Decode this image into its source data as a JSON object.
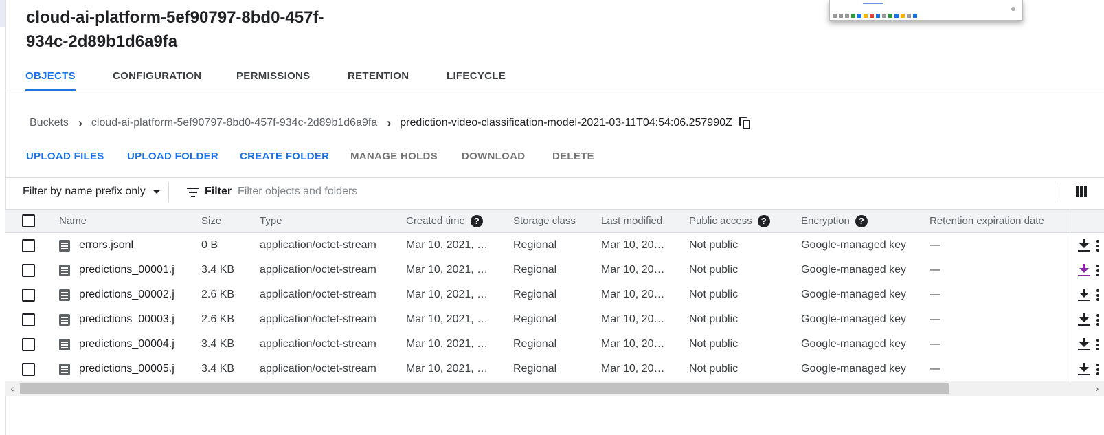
{
  "bucket_title": "cloud-ai-platform-5ef90797-8bd0-457f-934c-2d89b1d6a9fa",
  "tabs": [
    {
      "label": "OBJECTS",
      "active": true
    },
    {
      "label": "CONFIGURATION"
    },
    {
      "label": "PERMISSIONS"
    },
    {
      "label": "RETENTION"
    },
    {
      "label": "LIFECYCLE"
    }
  ],
  "breadcrumb": {
    "root": "Buckets",
    "bucket": "cloud-ai-platform-5ef90797-8bd0-457f-934c-2d89b1d6a9fa",
    "folder": "prediction-video-classification-model-2021-03-11T04:54:06.257990Z"
  },
  "actions": {
    "upload_files": "UPLOAD FILES",
    "upload_folder": "UPLOAD FOLDER",
    "create_folder": "CREATE FOLDER",
    "manage_holds": "MANAGE HOLDS",
    "download": "DOWNLOAD",
    "delete": "DELETE"
  },
  "filter": {
    "prefix_mode": "Filter by name prefix only",
    "label": "Filter",
    "placeholder": "Filter objects and folders"
  },
  "table": {
    "headers": {
      "name": "Name",
      "size": "Size",
      "type": "Type",
      "created": "Created time",
      "storage": "Storage class",
      "modified": "Last modified",
      "public": "Public access",
      "encryption": "Encryption",
      "retention": "Retention expiration date"
    },
    "rows": [
      {
        "name": "errors.jsonl",
        "size": "0 B",
        "type": "application/octet-stream",
        "created": "Mar 10, 2021, …",
        "storage": "Regional",
        "modified": "Mar 10, 20…",
        "public": "Not public",
        "encryption": "Google-managed key",
        "retention": "—"
      },
      {
        "name": "predictions_00001.j",
        "size": "3.4 KB",
        "type": "application/octet-stream",
        "created": "Mar 10, 2021, …",
        "storage": "Regional",
        "modified": "Mar 10, 20…",
        "public": "Not public",
        "encryption": "Google-managed key",
        "retention": "—",
        "download_visited": true
      },
      {
        "name": "predictions_00002.j",
        "size": "2.6 KB",
        "type": "application/octet-stream",
        "created": "Mar 10, 2021, …",
        "storage": "Regional",
        "modified": "Mar 10, 20…",
        "public": "Not public",
        "encryption": "Google-managed key",
        "retention": "—"
      },
      {
        "name": "predictions_00003.j",
        "size": "2.6 KB",
        "type": "application/octet-stream",
        "created": "Mar 10, 2021, …",
        "storage": "Regional",
        "modified": "Mar 10, 20…",
        "public": "Not public",
        "encryption": "Google-managed key",
        "retention": "—"
      },
      {
        "name": "predictions_00004.j",
        "size": "3.4 KB",
        "type": "application/octet-stream",
        "created": "Mar 10, 2021, …",
        "storage": "Regional",
        "modified": "Mar 10, 20…",
        "public": "Not public",
        "encryption": "Google-managed key",
        "retention": "—"
      },
      {
        "name": "predictions_00005.j",
        "size": "3.4 KB",
        "type": "application/octet-stream",
        "created": "Mar 10, 2021, …",
        "storage": "Regional",
        "modified": "Mar 10, 20…",
        "public": "Not public",
        "encryption": "Google-managed key",
        "retention": "—"
      }
    ]
  },
  "icons": {
    "help": "?",
    "row_file": "file-text-icon",
    "row_download": "download-icon",
    "row_more": "more-vert-icon",
    "copy": "copy-icon",
    "columns": "column-display-icon",
    "filter": "filter-list-icon"
  },
  "colors": {
    "accent": "#1a73e8",
    "visited_download": "#8e24aa",
    "disabled_action": "#757575"
  }
}
